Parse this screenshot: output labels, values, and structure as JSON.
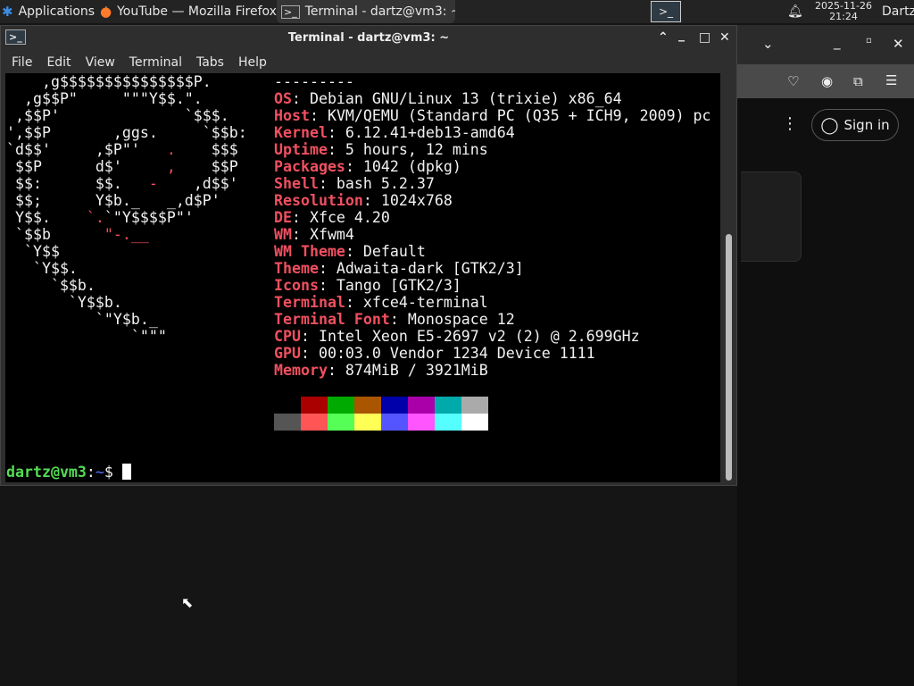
{
  "panel": {
    "applications": "Applications",
    "tasks": [
      {
        "label": "YouTube — Mozilla Firefox",
        "icon": "firefox-icon"
      },
      {
        "label": "Terminal - dartz@vm3: ~",
        "icon": "terminal-icon"
      }
    ],
    "clock_date": "2025-11-26",
    "clock_time": "21:24",
    "user": "Dartz"
  },
  "firefox": {
    "sign_in": "Sign in"
  },
  "terminal": {
    "title": "Terminal - dartz@vm3: ~",
    "menu": [
      "File",
      "Edit",
      "View",
      "Terminal",
      "Tabs",
      "Help"
    ],
    "logo": [
      [
        [
          "    ,g$$$$$$$$$$$$$$$P.",
          ""
        ]
      ],
      [
        [
          "  ,g$$P\"     \"\"\"Y$$.\".",
          ""
        ]
      ],
      [
        [
          " ,$$P'              `$$$.",
          ""
        ]
      ],
      [
        [
          "',$$P       ,ggs.     `$$b:",
          ""
        ]
      ],
      [
        [
          "`d$$'     ,$P\"'   ",
          ""
        ],
        [
          ".",
          "r"
        ],
        [
          "    $$$",
          ""
        ]
      ],
      [
        [
          " $$P      d$'     ",
          ""
        ],
        [
          ",",
          "r"
        ],
        [
          "    $$P",
          ""
        ]
      ],
      [
        [
          " $$:      $$.   ",
          ""
        ],
        [
          "-",
          "r"
        ],
        [
          "    ,d$$'",
          ""
        ]
      ],
      [
        [
          " $$;      Y$b._   _,d$P'",
          ""
        ]
      ],
      [
        [
          " Y$$.    ",
          ""
        ],
        [
          "`.",
          "r"
        ],
        [
          "`\"Y$$$$P\"'",
          ""
        ]
      ],
      [
        [
          " `$$b      ",
          ""
        ],
        [
          "\"-.__",
          "r"
        ]
      ],
      [
        [
          "  `Y$$",
          ""
        ]
      ],
      [
        [
          "   `Y$$.",
          ""
        ]
      ],
      [
        [
          "     `$$b.",
          ""
        ]
      ],
      [
        [
          "       `Y$$b.",
          ""
        ]
      ],
      [
        [
          "          `\"Y$b._",
          ""
        ]
      ],
      [
        [
          "              `\"\"\"",
          ""
        ]
      ]
    ],
    "separator": "---------",
    "info": [
      [
        "OS",
        "Debian GNU/Linux 13 (trixie) x86_64"
      ],
      [
        "Host",
        "KVM/QEMU (Standard PC (Q35 + ICH9, 2009) pc"
      ],
      [
        "Kernel",
        "6.12.41+deb13-amd64"
      ],
      [
        "Uptime",
        "5 hours, 12 mins"
      ],
      [
        "Packages",
        "1042 (dpkg)"
      ],
      [
        "Shell",
        "bash 5.2.37"
      ],
      [
        "Resolution",
        "1024x768"
      ],
      [
        "DE",
        "Xfce 4.20"
      ],
      [
        "WM",
        "Xfwm4"
      ],
      [
        "WM Theme",
        "Default"
      ],
      [
        "Theme",
        "Adwaita-dark [GTK2/3]"
      ],
      [
        "Icons",
        "Tango [GTK2/3]"
      ],
      [
        "Terminal",
        "xfce4-terminal"
      ],
      [
        "Terminal Font",
        "Monospace 12"
      ],
      [
        "CPU",
        "Intel Xeon E5-2697 v2 (2) @ 2.699GHz"
      ],
      [
        "GPU",
        "00:03.0 Vendor 1234 Device 1111"
      ],
      [
        "Memory",
        "874MiB / 3921MiB"
      ]
    ],
    "palette_normal": [
      "#000000",
      "#aa0000",
      "#00aa00",
      "#aa5500",
      "#0000aa",
      "#aa00aa",
      "#00aaaa",
      "#aaaaaa"
    ],
    "palette_bright": [
      "#555555",
      "#ff5555",
      "#55ff55",
      "#ffff55",
      "#5555ff",
      "#ff55ff",
      "#55ffff",
      "#ffffff"
    ],
    "prompt_user": "dartz@vm3",
    "prompt_sep": ":",
    "prompt_path": "~",
    "prompt_sym": "$ "
  },
  "colors": {
    "label": "#f05060",
    "prompt_green": "#55dd55",
    "prompt_path": "#5577ff"
  }
}
